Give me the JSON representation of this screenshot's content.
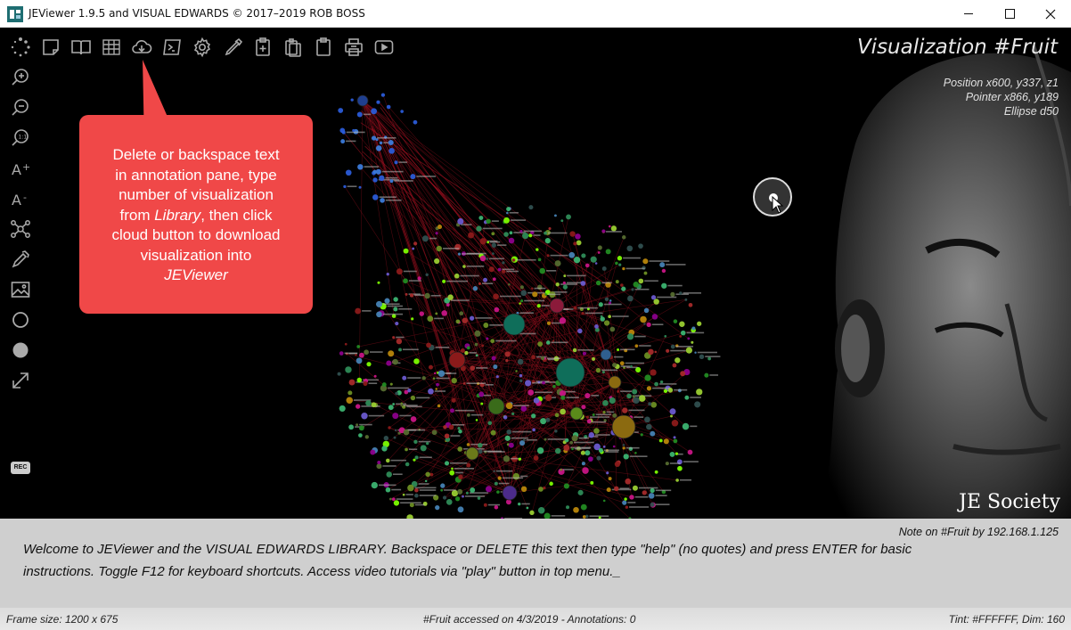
{
  "window": {
    "title": "JEViewer 1.9.5 and VISUAL EDWARDS © 2017–2019 ROB BOSS"
  },
  "toolbar": {
    "icons": [
      "loading-spinner-icon",
      "note-icon",
      "book-icon",
      "grid-icon",
      "cloud-download-icon",
      "terminal-icon",
      "gear-icon",
      "pen-icon",
      "clipboard-add-icon",
      "clipboard-copy-icon",
      "clipboard-icon",
      "printer-icon",
      "play-icon"
    ]
  },
  "sidebar": {
    "icons": [
      "zoom-in-icon",
      "zoom-out-icon",
      "zoom-reset-icon",
      "font-increase-icon",
      "font-decrease-icon",
      "network-icon",
      "eyedropper-icon",
      "image-icon",
      "circle-outline-icon",
      "circle-filled-icon",
      "expand-icon"
    ],
    "rec_label": "REC"
  },
  "visualization": {
    "title": "Visualization #Fruit",
    "position": "Position x600, y337, z1",
    "pointer": "Pointer x866, y189",
    "ellipse": "Ellipse d50"
  },
  "callout": {
    "line1": "Delete or backspace text",
    "line2": "in annotation pane, type",
    "line3": "number of visualization",
    "line4_pre": "from ",
    "line4_italic": "Library",
    "line4_post": ", then click",
    "line5": "cloud button to download",
    "line6": "visualization into",
    "line7": "JEViewer"
  },
  "watermark": "JE Society",
  "annotation": {
    "note_by": "Note on #Fruit by 192.168.1.125",
    "text": "Welcome to JEViewer and the VISUAL EDWARDS LIBRARY. Backspace or DELETE this text then type \"help\" (no quotes) and press ENTER for basic instructions. Toggle F12 for keyboard shortcuts. Access video tutorials via \"play\" button in top menu._"
  },
  "status": {
    "frame_size": "Frame size: 1200 x 675",
    "accessed": "#Fruit accessed on 4/3/2019 - Annotations: 0",
    "tint": "Tint: #FFFFFF, Dim: 160"
  },
  "colors": {
    "callout": "#f04848",
    "accent_red": "#c0152a"
  }
}
